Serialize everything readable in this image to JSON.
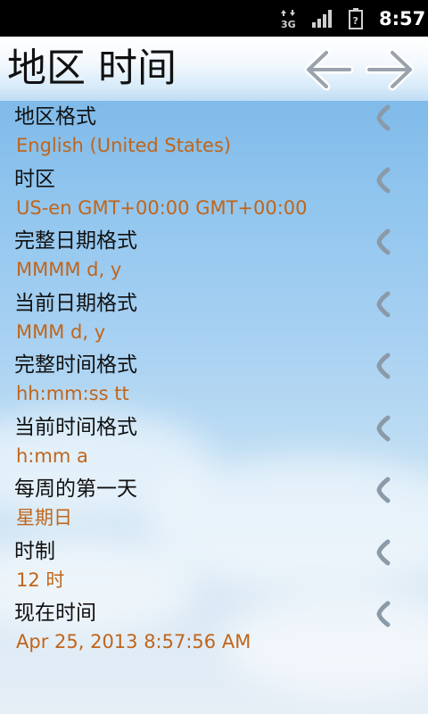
{
  "status_bar": {
    "time": "8:57",
    "icons": [
      "3g-data-icon",
      "signal-strength-icon",
      "battery-icon"
    ]
  },
  "header": {
    "title": "地区 时间",
    "back_icon": "arrow-left-icon",
    "forward_icon": "arrow-right-icon"
  },
  "settings": [
    {
      "label": "地区格式",
      "value": "English (United States)"
    },
    {
      "label": "时区",
      "value": "US-en GMT+00:00 GMT+00:00"
    },
    {
      "label": "完整日期格式",
      "value": "MMMM d, y"
    },
    {
      "label": "当前日期格式",
      "value": "MMM d, y"
    },
    {
      "label": "完整时间格式",
      "value": "hh:mm:ss tt"
    },
    {
      "label": "当前时间格式",
      "value": "h:mm a"
    },
    {
      "label": "每周的第一天",
      "value": "星期日"
    },
    {
      "label": "时制",
      "value": "12 时"
    },
    {
      "label": "现在时间",
      "value": "Apr 25, 2013 8:57:56 AM"
    }
  ],
  "colors": {
    "value_text": "#c0651a",
    "label_text": "#111111",
    "chevron": "#8a9aa8",
    "status_bar": "#000000"
  }
}
